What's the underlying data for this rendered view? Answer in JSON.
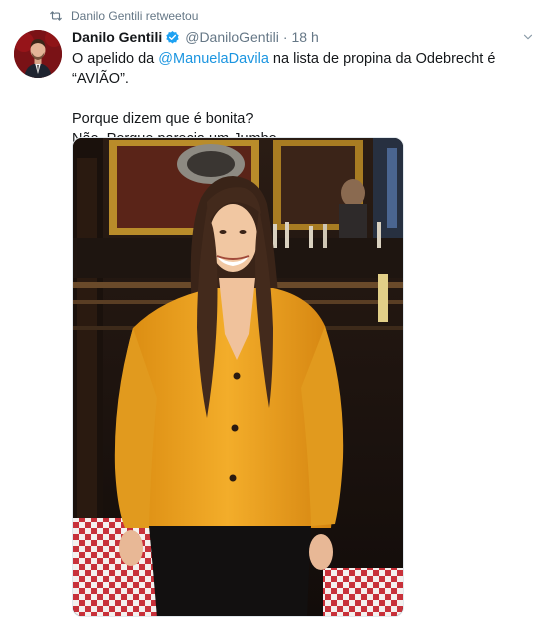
{
  "retweet_context": {
    "icon": "retweet-icon",
    "text": "Danilo Gentili retweetou"
  },
  "author": {
    "display_name": "Danilo Gentili",
    "verified": true,
    "handle": "@DaniloGentili",
    "separator": "·",
    "time": "18 h"
  },
  "tweet": {
    "line1_prefix": "O apelido da ",
    "line1_mention": "@ManuelaDavila",
    "line1_suffix": " na lista de propina da Odebrecht é “AVIÃO”.",
    "line2": "Porque dizem que é bonita?",
    "line3": "Não. Porque parecia um Jumbo."
  },
  "colors": {
    "link": "#1b95e0",
    "muted": "#657786",
    "text": "#14171a",
    "verified": "#1da1f2"
  }
}
